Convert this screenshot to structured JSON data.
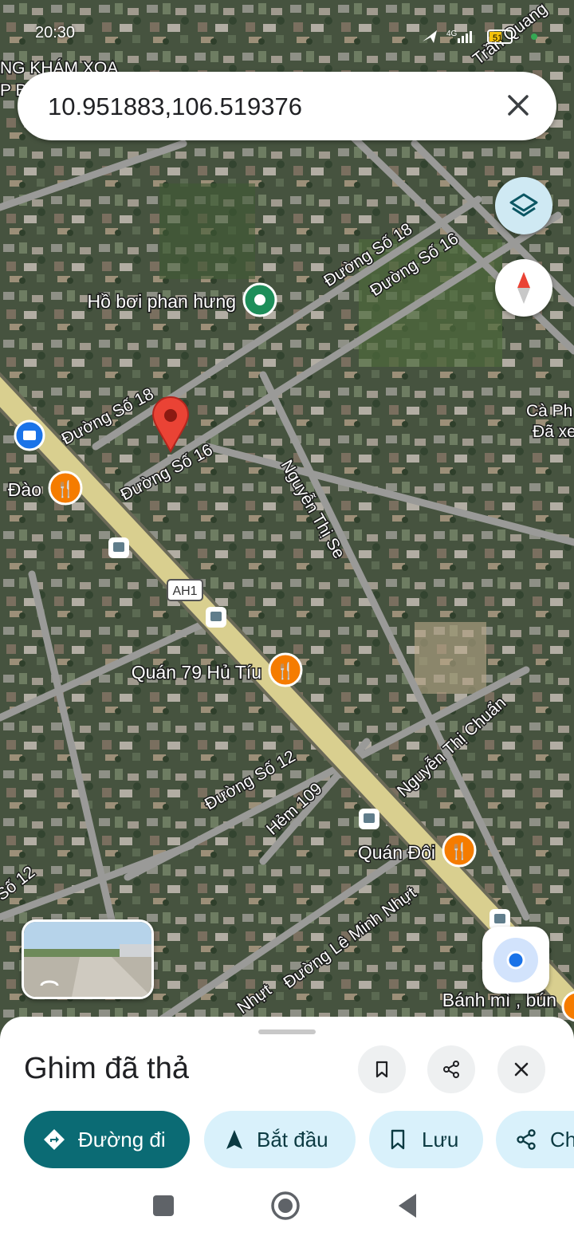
{
  "status_bar": {
    "time": "20:30",
    "network": "4G",
    "battery": "51"
  },
  "search": {
    "query": "10.951883,106.519376"
  },
  "map": {
    "poi": [
      {
        "name": "Hồ bơi phan hưng",
        "kind": "green"
      },
      {
        "name": "Quán 79 Hủ Tíu",
        "kind": "food"
      },
      {
        "name": "Quán Đôi",
        "kind": "food"
      },
      {
        "name": "Đào",
        "kind": "food"
      },
      {
        "name": "Bánh mì , bún",
        "kind": "food"
      }
    ],
    "streets": [
      "Đường Số 18",
      "Đường Số 16",
      "Đường Số 18",
      "Đường Số 16",
      "Nguyễn Thị Se",
      "Đường Số 12",
      "Hẻm 109",
      "Nguyễn Thị Chuẩn",
      "Đường Lê Minh Nhựt",
      "Số 12",
      "Nhựt",
      "Trần Quang",
      "AH1"
    ],
    "partial_labels": [
      "NG KHÁM XOA",
      "P B",
      "Cà Ph",
      "Đã xem"
    ],
    "marker_color": "#ea4335"
  },
  "sheet": {
    "title": "Ghim đã thả",
    "actions": [
      {
        "label": "Đường đi",
        "icon": "directions-icon"
      },
      {
        "label": "Bắt đầu",
        "icon": "navigation-arrow-icon"
      },
      {
        "label": "Lưu",
        "icon": "bookmark-icon"
      },
      {
        "label": "Ch",
        "icon": "share-icon"
      }
    ]
  },
  "colors": {
    "primary": "#0b6b74",
    "chip_bg": "#d9f1fb",
    "road": "#9a9a98",
    "highway": "#d9cf8f"
  }
}
